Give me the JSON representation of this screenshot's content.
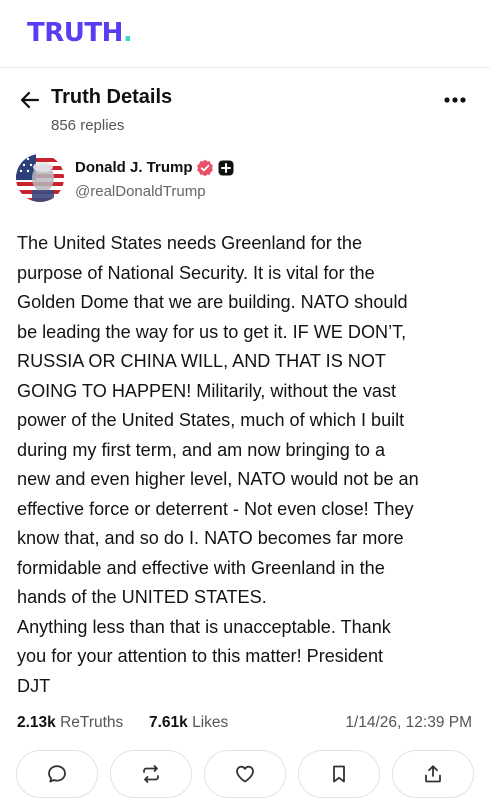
{
  "app": {
    "logo_text": "TRUTH",
    "logo_dot": ".",
    "brand_color": "#5a3df0",
    "dot_color": "#3fd7c4"
  },
  "header": {
    "title": "Truth Details",
    "replies": "856 replies",
    "back_icon": "arrow-left-icon",
    "more_icon": "more-horizontal-icon"
  },
  "author": {
    "name": "Donald J. Trump",
    "handle": "@realDonaldTrump",
    "verified_color": "#e8506a"
  },
  "post": {
    "lines": [
      "The United States needs Greenland for the",
      "purpose of National Security. It is vital for the",
      "Golden Dome that we are building. NATO should",
      "be leading the way for us to get it. IF WE DON’T,",
      "RUSSIA OR CHINA WILL, AND THAT IS NOT",
      "GOING TO HAPPEN! Militarily, without the vast",
      "power of the United States, much of which I built",
      "during my first term, and am now bringing to a",
      "new and even higher level, NATO would not be an",
      "effective force or deterrent - Not even close! They",
      "know that, and so do I. NATO becomes far more",
      "formidable and effective with Greenland in the",
      "hands of the UNITED STATES.",
      "Anything less than that is unacceptable. Thank",
      "you for your attention to this matter! President",
      "DJT"
    ]
  },
  "stats": {
    "retruths_count": "2.13k",
    "retruths_label": "ReTruths",
    "likes_count": "7.61k",
    "likes_label": "Likes",
    "timestamp": "1/14/26, 12:39 PM"
  },
  "actions": [
    {
      "icon": "reply-icon"
    },
    {
      "icon": "retruth-icon"
    },
    {
      "icon": "like-icon"
    },
    {
      "icon": "bookmark-icon"
    },
    {
      "icon": "share-icon"
    }
  ]
}
